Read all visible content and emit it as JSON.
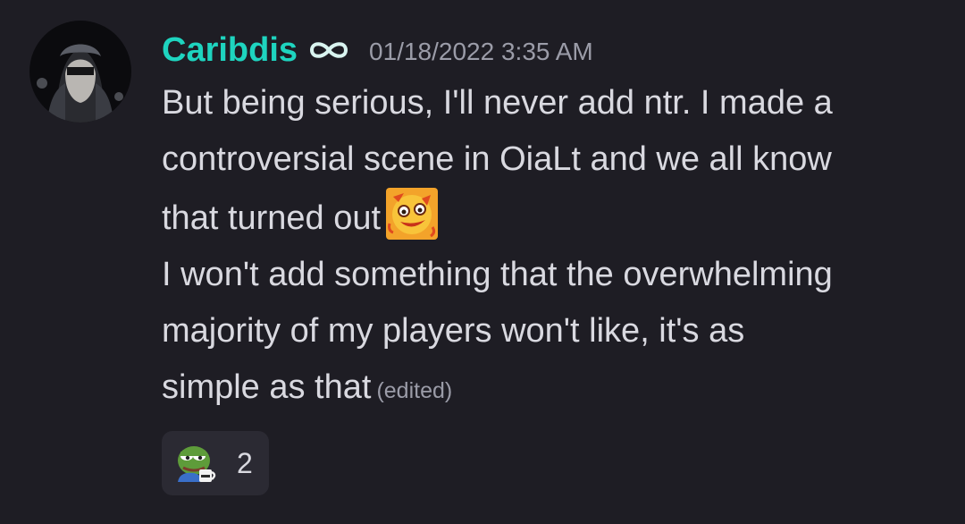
{
  "message": {
    "author": "Caribdis",
    "role_icon": "infinity-icon",
    "role_color": "#1ed4bf",
    "timestamp": "01/18/2022 3:35 AM",
    "lines": [
      "But being serious, I'll never add ntr. I made a",
      "controversial scene in OiaLt and we all know",
      "that turned out",
      "I won't add something that the overwhelming",
      "majority of my players won't like, it's as",
      "simple as that"
    ],
    "inline_emoji": "sweating-laugh-emoji",
    "edited_label": "(edited)"
  },
  "reactions": [
    {
      "emoji": "pepe-drinking-coffee-emoji",
      "count": "2"
    }
  ]
}
